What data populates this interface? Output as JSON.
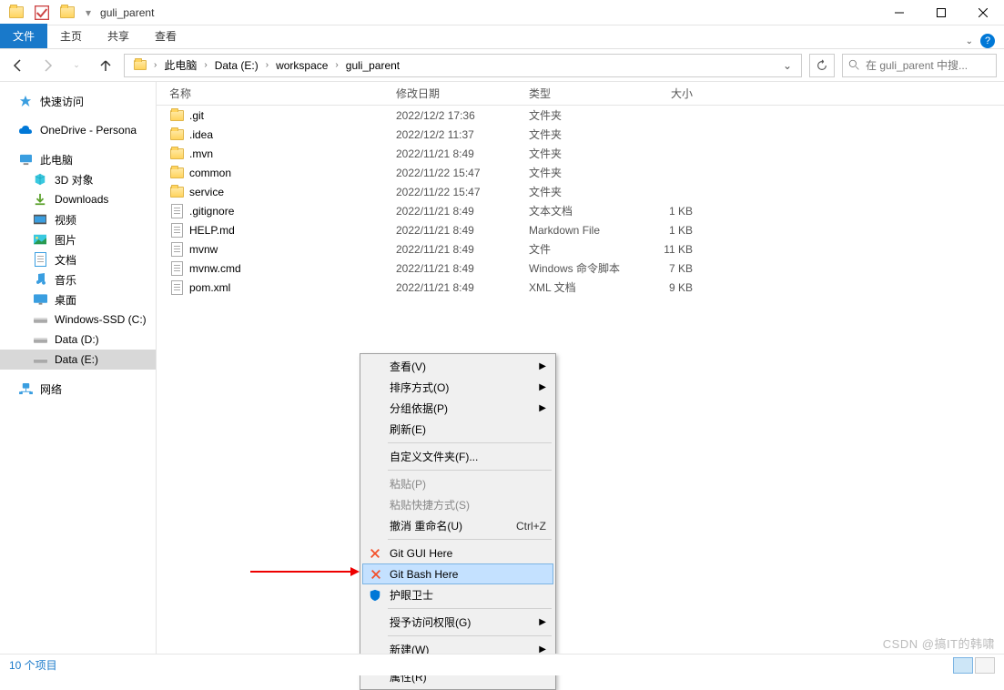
{
  "window": {
    "title": "guli_parent",
    "min": "—",
    "max": "☐",
    "close": "✕"
  },
  "ribbon": {
    "file": "文件",
    "tabs": [
      "主页",
      "共享",
      "查看"
    ]
  },
  "breadcrumb": {
    "items": [
      "此电脑",
      "Data (E:)",
      "workspace",
      "guli_parent"
    ]
  },
  "search": {
    "placeholder": "在 guli_parent 中搜..."
  },
  "columns": {
    "name": "名称",
    "date": "修改日期",
    "type": "类型",
    "size": "大小"
  },
  "sidebar": {
    "quick": "快速访问",
    "onedrive": "OneDrive - Persona",
    "thispc": "此电脑",
    "pc_children": [
      "3D 对象",
      "Downloads",
      "视频",
      "图片",
      "文档",
      "音乐",
      "桌面",
      "Windows-SSD (C:)",
      "Data (D:)",
      "Data (E:)"
    ],
    "network": "网络"
  },
  "files": [
    {
      "name": ".git",
      "date": "2022/12/2 17:36",
      "type": "文件夹",
      "size": "",
      "icon": "folder"
    },
    {
      "name": ".idea",
      "date": "2022/12/2 11:37",
      "type": "文件夹",
      "size": "",
      "icon": "folder"
    },
    {
      "name": ".mvn",
      "date": "2022/11/21 8:49",
      "type": "文件夹",
      "size": "",
      "icon": "folder"
    },
    {
      "name": "common",
      "date": "2022/11/22 15:47",
      "type": "文件夹",
      "size": "",
      "icon": "folder"
    },
    {
      "name": "service",
      "date": "2022/11/22 15:47",
      "type": "文件夹",
      "size": "",
      "icon": "folder"
    },
    {
      "name": ".gitignore",
      "date": "2022/11/21 8:49",
      "type": "文本文档",
      "size": "1 KB",
      "icon": "doc"
    },
    {
      "name": "HELP.md",
      "date": "2022/11/21 8:49",
      "type": "Markdown File",
      "size": "1 KB",
      "icon": "doc"
    },
    {
      "name": "mvnw",
      "date": "2022/11/21 8:49",
      "type": "文件",
      "size": "11 KB",
      "icon": "doc"
    },
    {
      "name": "mvnw.cmd",
      "date": "2022/11/21 8:49",
      "type": "Windows 命令脚本",
      "size": "7 KB",
      "icon": "doc"
    },
    {
      "name": "pom.xml",
      "date": "2022/11/21 8:49",
      "type": "XML 文档",
      "size": "9 KB",
      "icon": "doc"
    }
  ],
  "statusbar": {
    "count": "10 个项目"
  },
  "context_menu": {
    "view": "查看(V)",
    "sort": "排序方式(O)",
    "group": "分组依据(P)",
    "refresh": "刷新(E)",
    "customize": "自定义文件夹(F)...",
    "paste": "粘贴(P)",
    "paste_shortcut": "粘贴快捷方式(S)",
    "undo_rename": "撤消 重命名(U)",
    "undo_accel": "Ctrl+Z",
    "git_gui": "Git GUI Here",
    "git_bash": "Git Bash Here",
    "eyecare": "护眼卫士",
    "grant": "授予访问权限(G)",
    "new": "新建(W)",
    "props": "属性(R)"
  },
  "watermark": "CSDN @搞IT的韩啸"
}
